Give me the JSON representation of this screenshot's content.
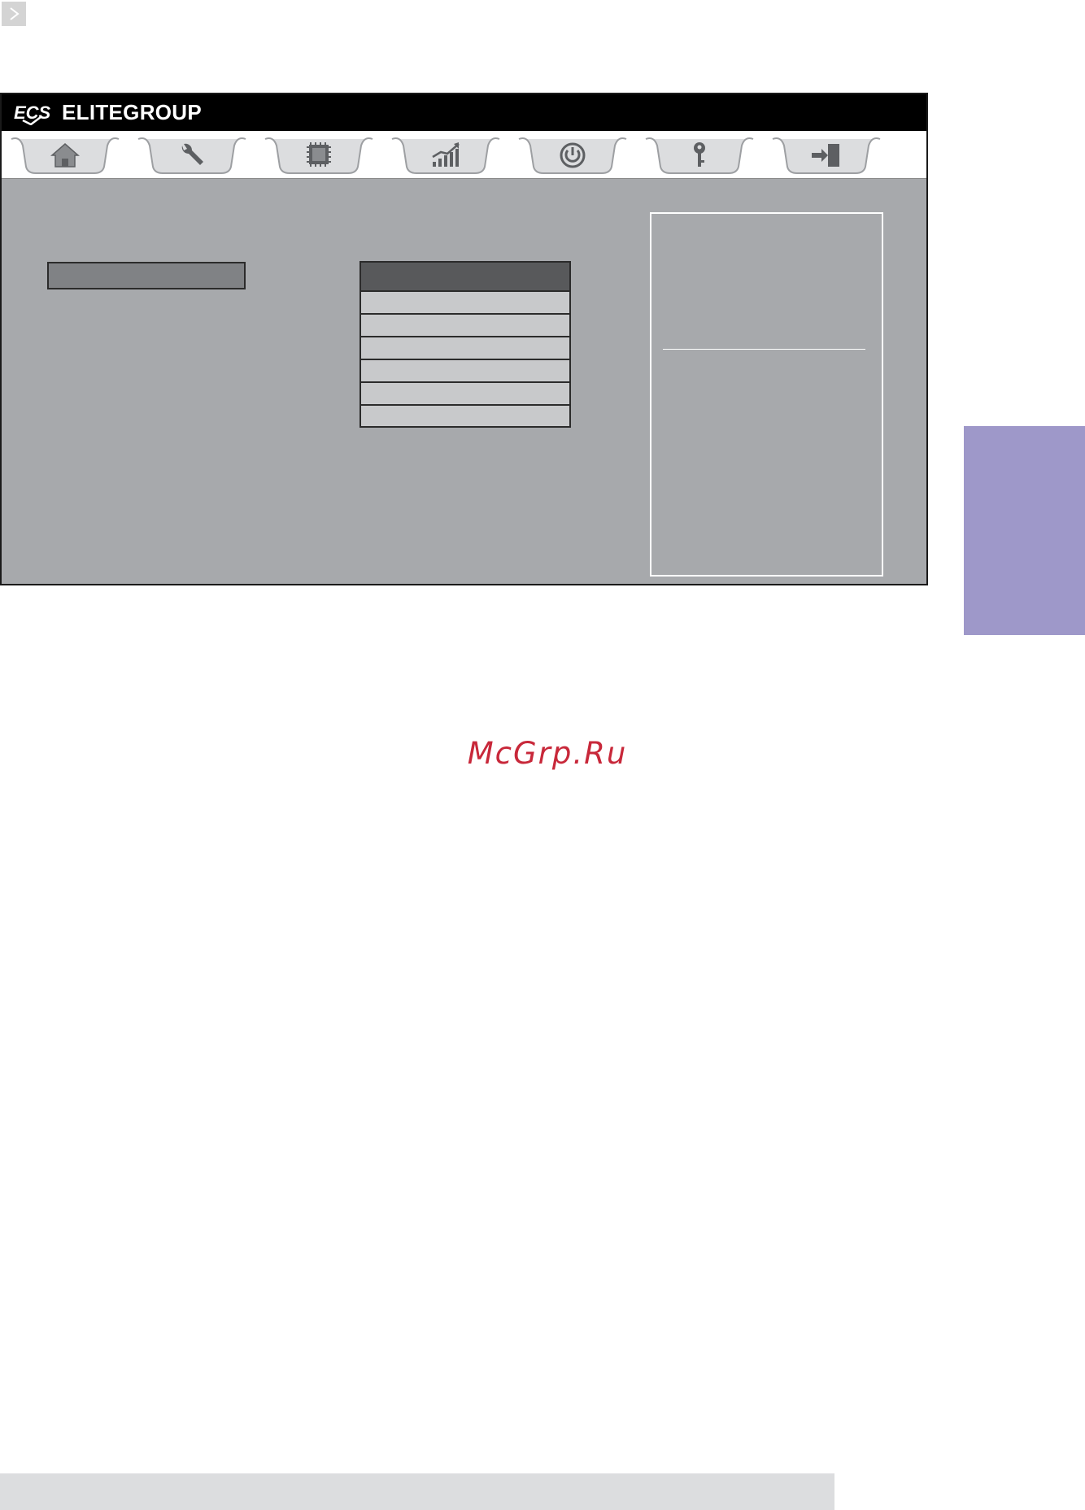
{
  "header": {
    "logo_text": "ECS",
    "brand_name": "ELITEGROUP"
  },
  "tabs": [
    {
      "icon": "home-icon"
    },
    {
      "icon": "wrench-icon"
    },
    {
      "icon": "chip-icon"
    },
    {
      "icon": "performance-chart-icon"
    },
    {
      "icon": "power-icon"
    },
    {
      "icon": "key-icon"
    },
    {
      "icon": "exit-door-icon"
    }
  ],
  "watermark": {
    "text": "McGrp.Ru"
  },
  "colors": {
    "body_background": "#a7a9ac",
    "header_background": "#000000",
    "side_tab": "#9e98c9",
    "watermark": "#c8283a"
  }
}
